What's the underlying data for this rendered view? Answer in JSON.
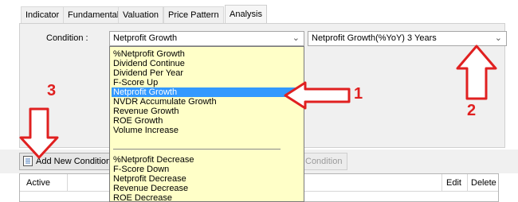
{
  "tabs": [
    "Indicator",
    "Fundamental",
    "Valuation",
    "Price Pattern",
    "Analysis"
  ],
  "condition_label": "Condition :",
  "combo_primary": "Netprofit Growth",
  "combo_secondary": "Netprofit Growth(%YoY) 3 Years",
  "dropdown_items": [
    "%Netprofit Growth",
    "Dividend Continue",
    "Dividend Per Year",
    "F-Score Up",
    "Netprofit Growth",
    "NVDR Accumulate Growth",
    "Revenue Growth",
    "ROE Growth",
    "Volume Increase",
    "%Netprofit Decrease",
    "F-Score Down",
    "Netprofit Decrease",
    "Revenue Decrease",
    "ROE Decrease"
  ],
  "toolbar": {
    "add_condition": "Add New Condition",
    "condition_button": "Condition"
  },
  "grid_headers": {
    "active": "Active",
    "edit": "Edit",
    "delete": "Delete"
  },
  "annotations": {
    "one": "1",
    "two": "2",
    "three": "3"
  },
  "colors": {
    "highlight": "#3399ff",
    "dropdown_bg": "#ffffc8",
    "annotation": "#e02020"
  }
}
